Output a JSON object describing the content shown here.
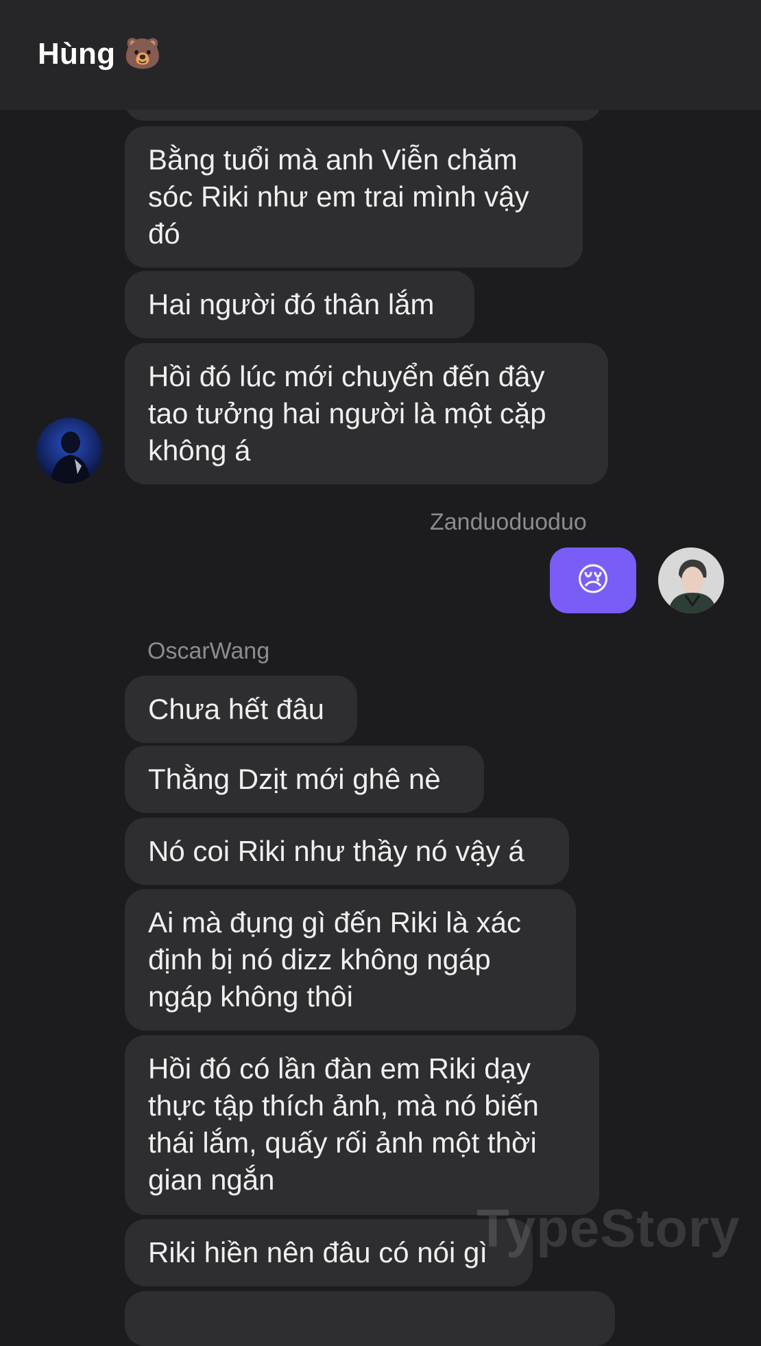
{
  "header": {
    "title": "Hùng 🐻"
  },
  "messages": {
    "m1": "Bằng tuổi mà anh Viễn chăm sóc Riki như em trai mình vậy đó",
    "m2": "Hai người đó thân lắm",
    "m3": "Hồi đó lúc mới chuyển đến đây tao tưởng hai người là một cặp không á",
    "me_name": "Zanduoduoduo",
    "me_emoji": "😢",
    "oscar_name": "OscarWang",
    "m4": "Chưa hết đâu",
    "m5": "Thằng Dzịt mới ghê nè",
    "m6": "Nó coi Riki như thầy nó vậy á",
    "m7": "Ai mà đụng gì đến Riki là xác định bị nó dizz không ngáp ngáp không thôi",
    "m8": "Hồi đó có lần đàn em Riki dạy thực tập thích ảnh, mà nó biến thái lắm, quấy rối ảnh một thời gian ngắn",
    "m9": "Riki hiền nên đâu có nói gì"
  },
  "watermark": "TypeStory"
}
